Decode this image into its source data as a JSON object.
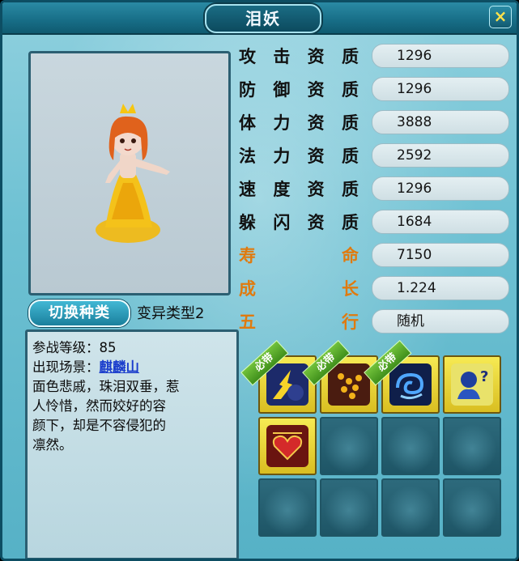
{
  "window": {
    "title": "泪妖",
    "close_label": "×"
  },
  "switch_button_label": "切换种类",
  "variant_label": "变异类型2",
  "stats": [
    {
      "label": [
        "攻",
        "击",
        "资",
        "质"
      ],
      "value": "1296",
      "color": "black"
    },
    {
      "label": [
        "防",
        "御",
        "资",
        "质"
      ],
      "value": "1296",
      "color": "black"
    },
    {
      "label": [
        "体",
        "力",
        "资",
        "质"
      ],
      "value": "3888",
      "color": "black"
    },
    {
      "label": [
        "法",
        "力",
        "资",
        "质"
      ],
      "value": "2592",
      "color": "black"
    },
    {
      "label": [
        "速",
        "度",
        "资",
        "质"
      ],
      "value": "1296",
      "color": "black"
    },
    {
      "label": [
        "躲",
        "闪",
        "资",
        "质"
      ],
      "value": "1684",
      "color": "black"
    },
    {
      "label": [
        "寿",
        "命"
      ],
      "value": "7150",
      "color": "orange"
    },
    {
      "label": [
        "成",
        "长"
      ],
      "value": "1.224",
      "color": "orange"
    },
    {
      "label": [
        "五",
        "行"
      ],
      "value": "随机",
      "color": "orange"
    }
  ],
  "description": {
    "level_line": "参战等级：85",
    "scene_prefix": "出现场景：",
    "scene_link": "麒麟山",
    "flavor_lines": [
      "面色悲戚，珠泪双垂，惹",
      "人怜惜，然而姣好的容",
      "颜下，却是不容侵犯的",
      "凛然。"
    ]
  },
  "skills": {
    "badge_text": "必带",
    "slots": [
      {
        "icon": "dark-lightning-skill-icon",
        "required": true
      },
      {
        "icon": "golden-beads-skill-icon",
        "required": true
      },
      {
        "icon": "blue-swirl-skill-icon",
        "required": true
      },
      {
        "icon": "hands-orb-question-skill-icon",
        "required": false
      },
      {
        "icon": "red-heart-emblem-skill-icon",
        "required": false
      },
      {
        "icon": "",
        "required": false
      },
      {
        "icon": "",
        "required": false
      },
      {
        "icon": "",
        "required": false
      },
      {
        "icon": "",
        "required": false
      },
      {
        "icon": "",
        "required": false
      },
      {
        "icon": "",
        "required": false
      },
      {
        "icon": "",
        "required": false
      }
    ]
  },
  "colors": {
    "accent_orange": "#e07a0e",
    "link_blue": "#1a3dcc",
    "skill_yellow": "#f6ea53"
  }
}
